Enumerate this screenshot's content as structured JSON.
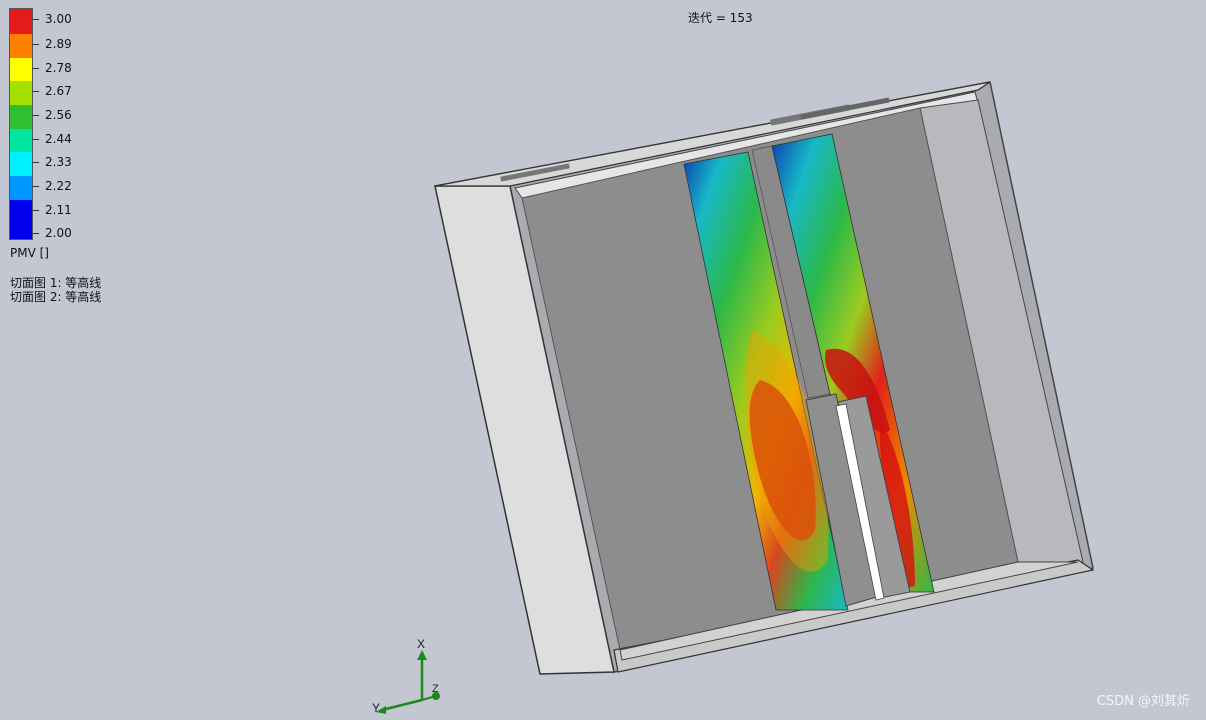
{
  "legend": {
    "title": "PMV []",
    "labels": [
      "3.00",
      "2.89",
      "2.78",
      "2.67",
      "2.56",
      "2.44",
      "2.33",
      "2.22",
      "2.11",
      "2.00"
    ],
    "colors": [
      "#e41a1c",
      "#ff7f00",
      "#ffff00",
      "#a6e000",
      "#2ec02e",
      "#00e5a0",
      "#00f0ff",
      "#0096ff",
      "#0000ee"
    ]
  },
  "cut_plots": [
    "切面图 1: 等高线",
    "切面图 2: 等高线"
  ],
  "iteration_text": "迭代 = 153",
  "axis_triad": {
    "x_label": "X",
    "y_label": "Y",
    "z_label": "Z"
  },
  "watermark": "CSDN @刘其炘",
  "colors": {
    "background": "#c3c7d2",
    "inner_wall": "#8d8d8d",
    "outer_frame": "#dcdcdc",
    "axis_green": "#1a8a1a"
  }
}
